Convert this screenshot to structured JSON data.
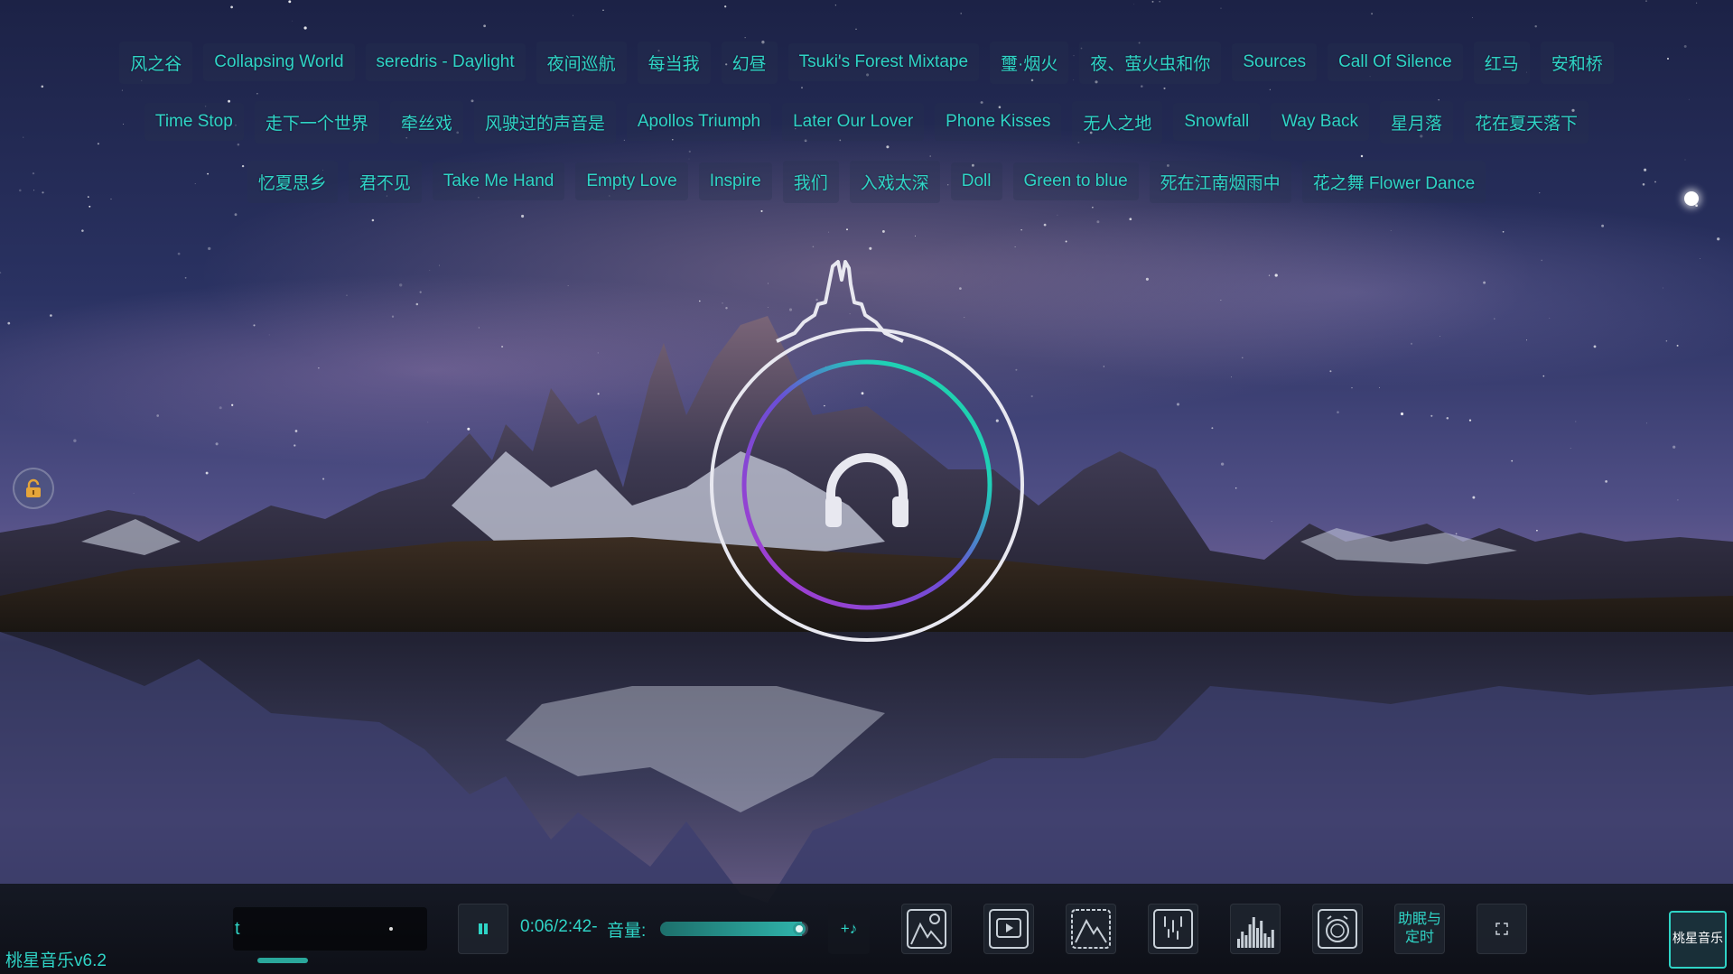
{
  "app": {
    "version_label": "桃星音乐v6.2",
    "logo_text": "桃星音乐"
  },
  "playlist": {
    "rows": [
      [
        "风之谷",
        "Collapsing World",
        "seredris - Daylight",
        "夜间巡航",
        "每当我",
        "幻昼",
        "Tsuki's Forest Mixtape",
        "璽·烟火",
        "夜、萤火虫和你",
        "Sources",
        "Call Of Silence",
        "红马",
        "安和桥"
      ],
      [
        "Time Stop",
        "走下一个世界",
        "牵丝戏",
        "风驶过的声音是",
        "Apollos Triumph",
        "Later Our Lover",
        "Phone Kisses",
        "无人之地",
        "Snowfall",
        "Way Back",
        "星月落",
        "花在夏天落下"
      ],
      [
        "忆夏思乡",
        "君不见",
        "Take Me Hand",
        "Empty Love",
        "Inspire",
        "我们",
        "入戏太深",
        "Doll",
        "Green to blue",
        "死在江南烟雨中",
        "花之舞 Flower Dance"
      ]
    ]
  },
  "player": {
    "lyric_text": "t",
    "time_display": "0:06/2:42-",
    "volume_label": "音量:",
    "volume_level": 0.96,
    "mini_progress": 0.26,
    "sleep_timer_label_line1": "助眠与",
    "sleep_timer_label_line2": "定时",
    "add_song_glyph": "+♪"
  },
  "colors": {
    "accent": "#2fd4c6",
    "ring_gradient": [
      "#b03ad0",
      "#1fd0b8",
      "#20d2a4"
    ]
  },
  "icons": {
    "play_pause": "pause-icon",
    "lock": "unlock-icon",
    "center": "headphones-icon",
    "controls": [
      "landscape-pin-icon",
      "video-frame-icon",
      "image-frame-icon",
      "rain-drops-icon",
      "spectrum-icon",
      "alarm-clock-icon",
      "fullscreen-icon"
    ]
  }
}
